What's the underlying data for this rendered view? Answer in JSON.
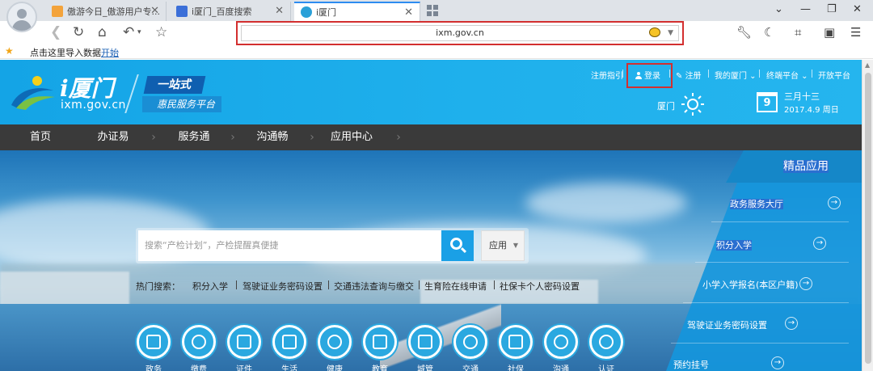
{
  "browser": {
    "tabs": [
      {
        "label": "傲游今日_傲游用户专..."
      },
      {
        "label": "i厦门_百度搜索"
      },
      {
        "label": "i厦门"
      }
    ],
    "url": "ixm.gov.cn",
    "bookmark_hint": "点击这里导入数据",
    "bookmark_link": "开始",
    "accent_color": "#2d8cf0",
    "highlight_color": "#d32f2f"
  },
  "header": {
    "logo_main": "i厦门",
    "logo_domain": "ixm.gov.cn",
    "slogan_primary": "一站式",
    "slogan_secondary": "惠民服务平台",
    "links": {
      "guide": "注册指引",
      "login": "登录",
      "register": "注册",
      "my_xiamen": "我的厦门",
      "terminal": "终端平台",
      "open": "开放平台"
    },
    "weather_city": "厦门",
    "calendar_day": "9",
    "lunar_date": "三月十三",
    "date": "2017.4.9 周日"
  },
  "nav": {
    "items": [
      "首页",
      "办证易",
      "服务通",
      "沟通畅",
      "应用中心"
    ]
  },
  "search": {
    "placeholder": "搜索“产检计划”，产检提醒真便捷",
    "select_value": "应用"
  },
  "hot": {
    "label": "热门搜索：",
    "items": [
      "积分入学",
      "驾驶证业务密码设置",
      "交通违法查询与缴交",
      "生育险在线申请",
      "社保卡个人密码设置"
    ]
  },
  "apps": [
    "政务",
    "缴费",
    "证件",
    "生活",
    "健康",
    "教育",
    "城管",
    "交通",
    "社保",
    "沟通",
    "认证"
  ],
  "right_panel": {
    "title": "精品应用",
    "items": [
      "政务服务大厅",
      "积分入学",
      "小学入学报名(本区户籍)",
      "驾驶证业务密码设置",
      "预约挂号"
    ]
  },
  "colors": {
    "header_blue": "#1fb0ec",
    "nav_dark": "#3a3a3a",
    "search_blue": "#1aa0e6",
    "panel_blue": "#1596dc"
  }
}
